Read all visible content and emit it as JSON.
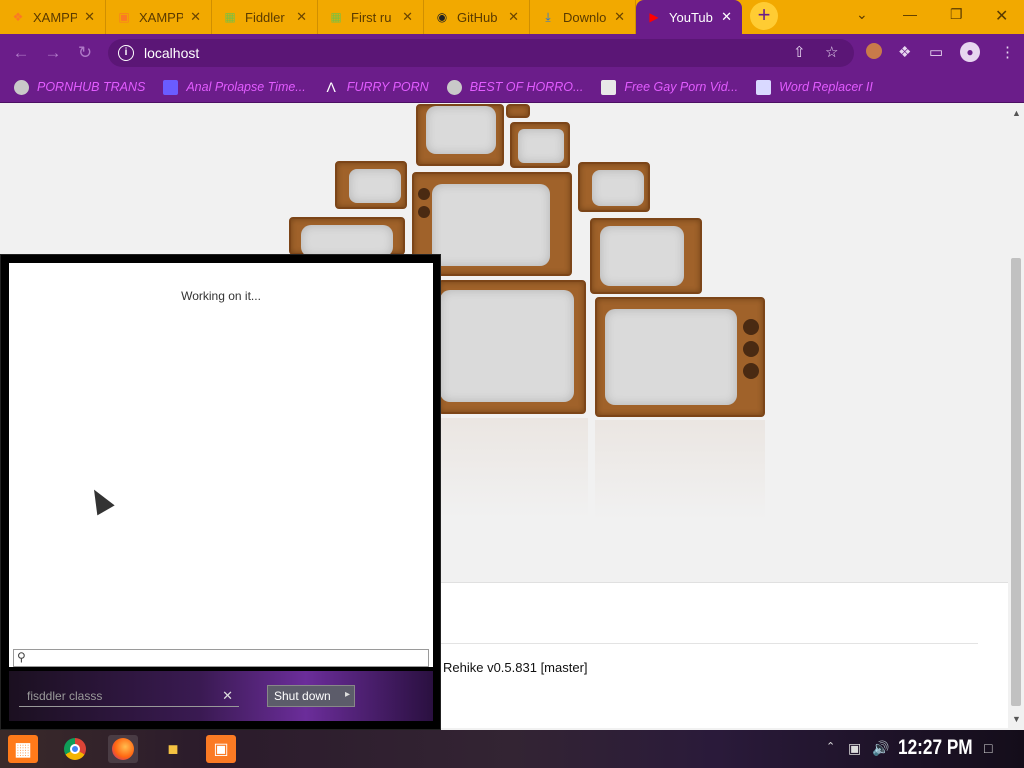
{
  "tabs": [
    {
      "label": "XAMPP",
      "icon": "xampp-icon",
      "color": "#fb7a24"
    },
    {
      "label": "XAMPP",
      "icon": "xampp-icon",
      "color": "#fb7a24"
    },
    {
      "label": "Fiddler",
      "icon": "fiddler-icon",
      "color": "#7ac043"
    },
    {
      "label": "First ru",
      "icon": "fiddler-icon",
      "color": "#7ac043"
    },
    {
      "label": "GitHub",
      "icon": "github-icon",
      "color": "#222222"
    },
    {
      "label": "Downlo",
      "icon": "download-icon",
      "color": "#1a73e8"
    },
    {
      "label": "YouTub",
      "icon": "youtube-icon",
      "color": "#ff0000",
      "active": true
    }
  ],
  "toolbar": {
    "url": "localhost"
  },
  "bookmarks": [
    {
      "label": "PORNHUB TRANS",
      "icon": "globe-icon"
    },
    {
      "label": "Anal Prolapse Time...",
      "icon": "bookmark-icon"
    },
    {
      "label": "FURRY PORN",
      "icon": "bookmark-icon"
    },
    {
      "label": "BEST OF HORRO...",
      "icon": "globe-icon"
    },
    {
      "label": "Free Gay Porn Vid...",
      "icon": "bookmark-icon"
    },
    {
      "label": "Word Replacer II",
      "icon": "bookmark-icon"
    }
  ],
  "page": {
    "version": "Rehike v0.5.831 [master]"
  },
  "fiddler": {
    "status": "Working on it...",
    "search_placeholder": "fisddler classs",
    "shutdown_label": "Shut down"
  },
  "taskbar": {
    "clock": "12:27 PM",
    "apps": [
      "start",
      "chrome",
      "firefox",
      "file-explorer",
      "xampp"
    ]
  },
  "colors": {
    "tabstrip": "#f2a900",
    "toolbar": "#6b1d8a",
    "bookmark_text": "#e25cff"
  }
}
